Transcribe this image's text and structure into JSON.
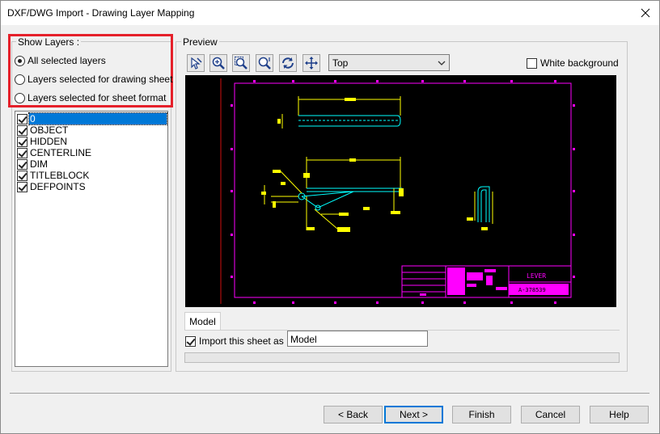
{
  "window": {
    "title": "DXF/DWG Import - Drawing Layer Mapping"
  },
  "show_layers": {
    "label": "Show Layers :",
    "options": [
      {
        "label": "All selected layers",
        "checked": true
      },
      {
        "label": "Layers selected for drawing sheet",
        "checked": false
      },
      {
        "label": "Layers selected for sheet format",
        "checked": false
      }
    ]
  },
  "layers": [
    {
      "name": "0",
      "checked": true,
      "selected": true
    },
    {
      "name": "OBJECT",
      "checked": true
    },
    {
      "name": "HIDDEN",
      "checked": true
    },
    {
      "name": "CENTERLINE",
      "checked": true
    },
    {
      "name": "DIM",
      "checked": true
    },
    {
      "name": "TITLEBLOCK",
      "checked": true
    },
    {
      "name": "DEFPOINTS",
      "checked": true
    }
  ],
  "preview": {
    "label": "Preview",
    "tools": [
      "select-icon",
      "zoom-in-icon",
      "zoom-area-icon",
      "zoom-fit-icon",
      "rotate-icon",
      "pan-icon"
    ],
    "view": "Top",
    "white_background_label": "White background",
    "white_background": false,
    "title_block_text": "LEVER",
    "title_block_number": "A-378539"
  },
  "sheet": {
    "tab": "Model",
    "import_label": "Import this sheet as :",
    "import_checked": true,
    "import_value": "Model"
  },
  "buttons": {
    "back": "< Back",
    "next": "Next >",
    "finish": "Finish",
    "cancel": "Cancel",
    "help": "Help"
  },
  "colors": {
    "canvas_bg": "#000000",
    "border_magenta": "#ff00ff",
    "geometry_yellow": "#ffff00",
    "geometry_cyan": "#00ffff",
    "accent_red": "#e5202a"
  }
}
